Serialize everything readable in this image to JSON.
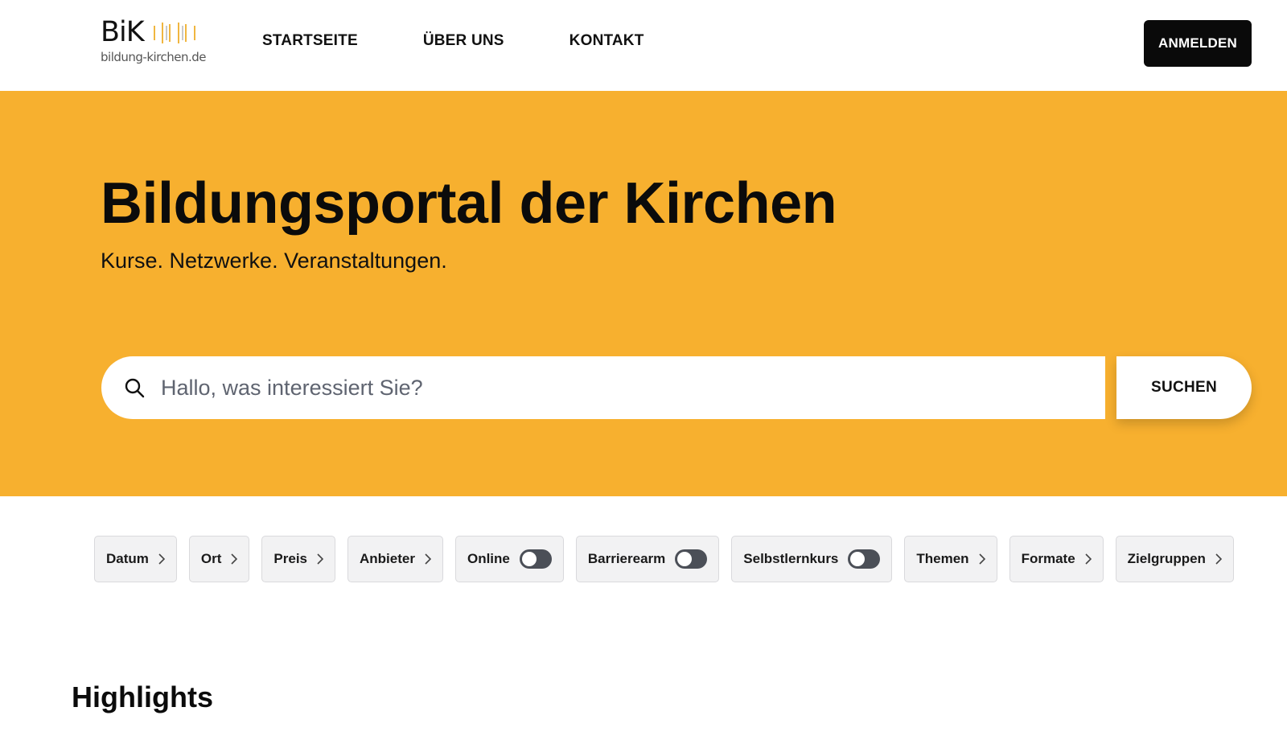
{
  "header": {
    "logo": {
      "word": "BiK",
      "domain": "bildung-kirchen.de"
    },
    "nav": [
      "STARTSEITE",
      "ÜBER UNS",
      "KONTAKT"
    ],
    "login_label": "ANMELDEN"
  },
  "hero": {
    "title": "Bildungsportal der Kirchen",
    "subtitle": "Kurse. Netzwerke. Veranstaltungen.",
    "search": {
      "placeholder": "Hallo, was interessiert Sie?",
      "value": ""
    },
    "search_button": "SUCHEN",
    "background_color": "#f7b02f"
  },
  "filters": {
    "datum": "Datum",
    "ort": "Ort",
    "preis": "Preis",
    "anbieter": "Anbieter",
    "online": {
      "label": "Online",
      "on": false
    },
    "barrierearm": {
      "label": "Barrierearm",
      "on": false
    },
    "selbstlernkurs": {
      "label": "Selbstlernkurs",
      "on": false
    },
    "themen": "Themen",
    "formate": "Formate",
    "zielgruppen": "Zielgruppen"
  },
  "section": {
    "highlights_title": "Highlights"
  },
  "icons": [
    "search-icon",
    "chevron-right-icon",
    "toggle-switch"
  ]
}
